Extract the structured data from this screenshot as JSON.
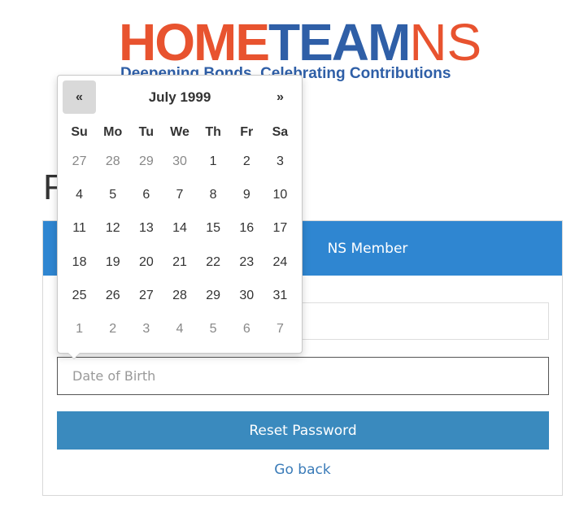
{
  "logo": {
    "part_home": "HOME",
    "part_team": "TEAM",
    "part_ns": "NS",
    "tagline": "Deepening Bonds, Celebrating Contributions",
    "colors": {
      "orange": "#e8532f",
      "blue": "#2f5fa7"
    }
  },
  "page": {
    "heading_visible": "R"
  },
  "panel": {
    "header_text": "NS Member",
    "header_color": "#2f86d1",
    "nric_value": "",
    "dob_placeholder": "Date of Birth",
    "reset_label": "Reset Password",
    "reset_color": "#3a8abe",
    "go_back_label": "Go back",
    "link_color": "#3a7bb8"
  },
  "datepicker": {
    "prev_label": "«",
    "next_label": "»",
    "title": "July 1999",
    "weekdays": [
      "Su",
      "Mo",
      "Tu",
      "We",
      "Th",
      "Fr",
      "Sa"
    ],
    "days": [
      {
        "label": "27",
        "muted": true
      },
      {
        "label": "28",
        "muted": true
      },
      {
        "label": "29",
        "muted": true
      },
      {
        "label": "30",
        "muted": true
      },
      {
        "label": "1",
        "muted": false
      },
      {
        "label": "2",
        "muted": false
      },
      {
        "label": "3",
        "muted": false
      },
      {
        "label": "4",
        "muted": false
      },
      {
        "label": "5",
        "muted": false
      },
      {
        "label": "6",
        "muted": false
      },
      {
        "label": "7",
        "muted": false
      },
      {
        "label": "8",
        "muted": false
      },
      {
        "label": "9",
        "muted": false
      },
      {
        "label": "10",
        "muted": false
      },
      {
        "label": "11",
        "muted": false
      },
      {
        "label": "12",
        "muted": false
      },
      {
        "label": "13",
        "muted": false
      },
      {
        "label": "14",
        "muted": false
      },
      {
        "label": "15",
        "muted": false
      },
      {
        "label": "16",
        "muted": false
      },
      {
        "label": "17",
        "muted": false
      },
      {
        "label": "18",
        "muted": false
      },
      {
        "label": "19",
        "muted": false
      },
      {
        "label": "20",
        "muted": false
      },
      {
        "label": "21",
        "muted": false
      },
      {
        "label": "22",
        "muted": false
      },
      {
        "label": "23",
        "muted": false
      },
      {
        "label": "24",
        "muted": false
      },
      {
        "label": "25",
        "muted": false
      },
      {
        "label": "26",
        "muted": false
      },
      {
        "label": "27",
        "muted": false
      },
      {
        "label": "28",
        "muted": false
      },
      {
        "label": "29",
        "muted": false
      },
      {
        "label": "30",
        "muted": false
      },
      {
        "label": "31",
        "muted": false
      },
      {
        "label": "1",
        "muted": true
      },
      {
        "label": "2",
        "muted": true
      },
      {
        "label": "3",
        "muted": true
      },
      {
        "label": "4",
        "muted": true
      },
      {
        "label": "5",
        "muted": true
      },
      {
        "label": "6",
        "muted": true
      },
      {
        "label": "7",
        "muted": true
      }
    ]
  }
}
